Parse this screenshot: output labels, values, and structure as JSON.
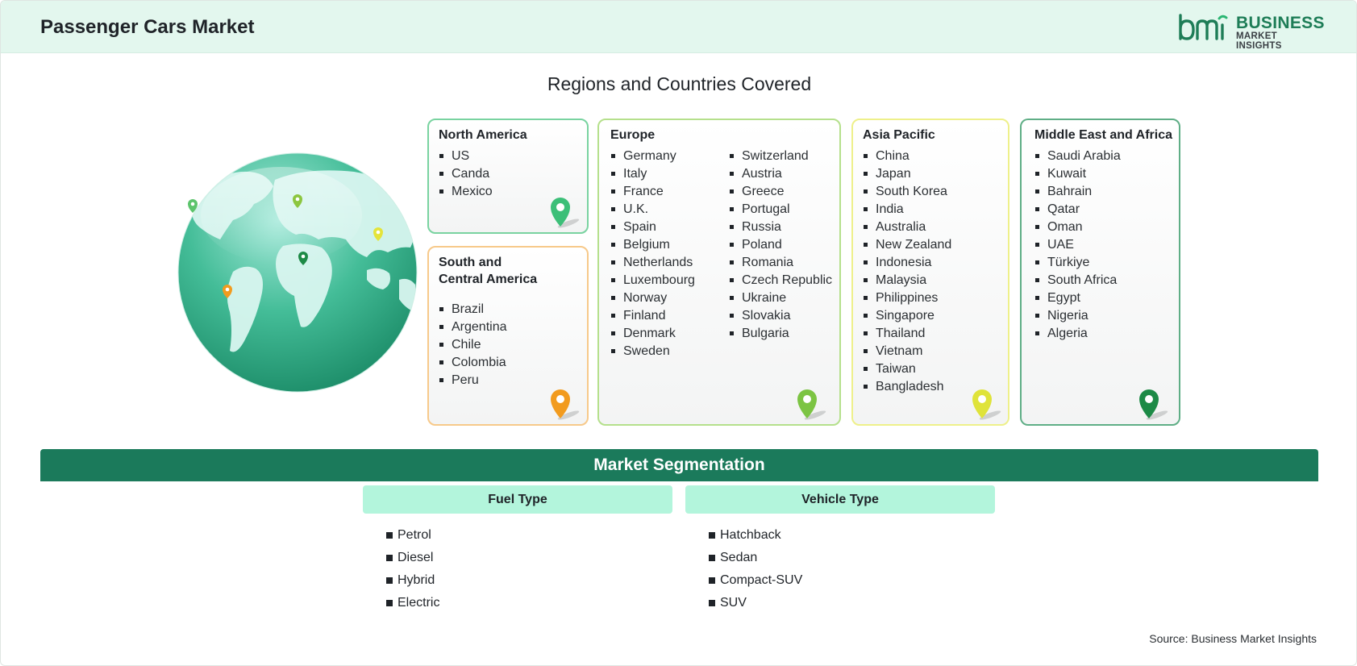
{
  "header": {
    "title": "Passenger Cars Market",
    "logo_line1": "BUSINESS",
    "logo_line2": "MARKET INSIGHTS",
    "logo_mark_text": "bmi"
  },
  "regions_title": "Regions and Countries Covered",
  "regions": {
    "north_america": {
      "title": "North America",
      "items": [
        "US",
        "Canda",
        "Mexico"
      ],
      "color": "#79d3a0",
      "pin_color": "#3cbf78"
    },
    "south_central_america": {
      "title_line1": "South and",
      "title_line2": "Central America",
      "items": [
        "Brazil",
        "Argentina",
        "Chile",
        "Colombia",
        "Peru"
      ],
      "color": "#f7c98a",
      "pin_color": "#f29b1e"
    },
    "europe": {
      "title": "Europe",
      "items_col1": [
        "Germany",
        "Italy",
        "France",
        "U.K.",
        "Spain",
        "Belgium",
        "Netherlands",
        "Luxembourg",
        "Norway",
        "Finland",
        "Denmark",
        "Sweden"
      ],
      "items_col2": [
        "Switzerland",
        "Austria",
        "Greece",
        "Portugal",
        "Russia",
        "Poland",
        "Romania",
        "Czech Republic",
        "Ukraine",
        "Slovakia",
        "Bulgaria"
      ],
      "color": "#b5e08c",
      "pin_color": "#7cc443"
    },
    "asia_pacific": {
      "title": "Asia Pacific",
      "items": [
        "China",
        "Japan",
        "South Korea",
        "India",
        "Australia",
        "New Zealand",
        "Indonesia",
        "Malaysia",
        "Philippines",
        "Singapore",
        "Thailand",
        "Vietnam",
        "Taiwan",
        "Bangladesh"
      ],
      "color": "#eef08a",
      "pin_color": "#dfe33a"
    },
    "middle_east_africa": {
      "title": "Middle East and Africa",
      "items": [
        "Saudi Arabia",
        "Kuwait",
        "Bahrain",
        "Qatar",
        "Oman",
        "UAE",
        "Türkiye",
        "South Africa",
        "Egypt",
        "Nigeria",
        "Algeria"
      ],
      "color": "#5fae86",
      "pin_color": "#1d8a46"
    }
  },
  "segmentation": {
    "title": "Market Segmentation",
    "fuel_type": {
      "title": "Fuel Type",
      "items": [
        "Petrol",
        "Diesel",
        "Hybrid",
        "Electric"
      ]
    },
    "vehicle_type": {
      "title": "Vehicle Type",
      "items": [
        "Hatchback",
        "Sedan",
        "Compact-SUV",
        "SUV"
      ]
    }
  },
  "source": "Source: Business Market Insights",
  "colors": {
    "header_bg": "#e3f7ee",
    "brand_green": "#1b7a5b",
    "segment_head_bg": "#b3f5dc"
  }
}
